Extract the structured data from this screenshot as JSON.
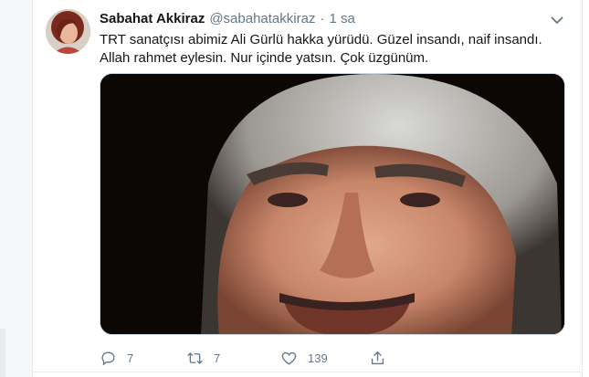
{
  "tweet": {
    "author_name": "Sabahat Akkiraz",
    "handle": "@sabahatakkiraz",
    "separator": "·",
    "time": "1 sa",
    "text": "TRT sanatçısı abimiz Ali Gürlü hakka yürüdü. Güzel insandı, naif insandı. Allah rahmet eylesin. Nur içinde yatsın. Çok üzgünüm.",
    "media_alt": "photo"
  },
  "actions": {
    "reply_count": "7",
    "retweet_count": "7",
    "like_count": "139"
  },
  "icons": {
    "more": "chevron-down-icon",
    "reply": "reply-icon",
    "retweet": "retweet-icon",
    "like": "heart-icon",
    "share": "share-icon"
  },
  "colors": {
    "text": "#14171a",
    "secondary": "#657786",
    "border": "#e6ecf0"
  }
}
